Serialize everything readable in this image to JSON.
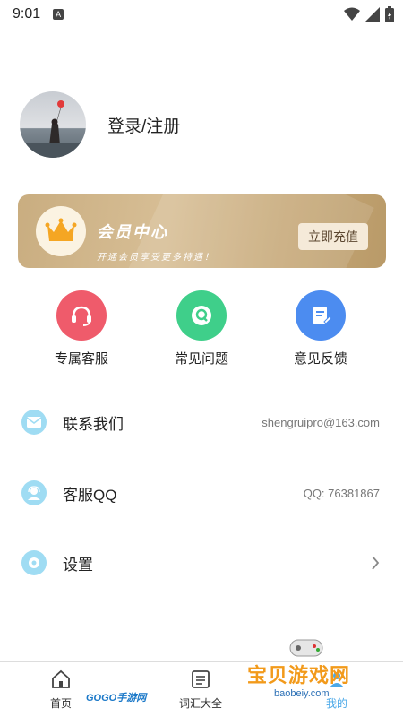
{
  "status_bar": {
    "time": "9:01",
    "notification_letter": "A"
  },
  "profile": {
    "login_label": "登录/注册"
  },
  "vip": {
    "title": "会员中心",
    "subtitle": "开通会员享受更多特遇！",
    "button_label": "立即充值"
  },
  "quick_actions": [
    {
      "label": "专属客服",
      "color": "#ef5b6b"
    },
    {
      "label": "常见问题",
      "color": "#3fcf8a"
    },
    {
      "label": "意见反馈",
      "color": "#4c8cf0"
    }
  ],
  "menu": [
    {
      "label": "联系我们",
      "value": "shengruipro@163.com"
    },
    {
      "label": "客服QQ",
      "value": "QQ: 76381867"
    },
    {
      "label": "设置"
    }
  ],
  "bottom_nav": [
    {
      "label": "首页"
    },
    {
      "label": "词汇大全"
    },
    {
      "label": "我的"
    }
  ],
  "watermarks": {
    "gogo": "GOGO手游网",
    "baobei": "宝贝游戏网",
    "baobei_url": "baobeiy.com"
  },
  "colors": {
    "accent_list_icon": "#9fdcf3",
    "vip_gold": "#c9ad80"
  }
}
